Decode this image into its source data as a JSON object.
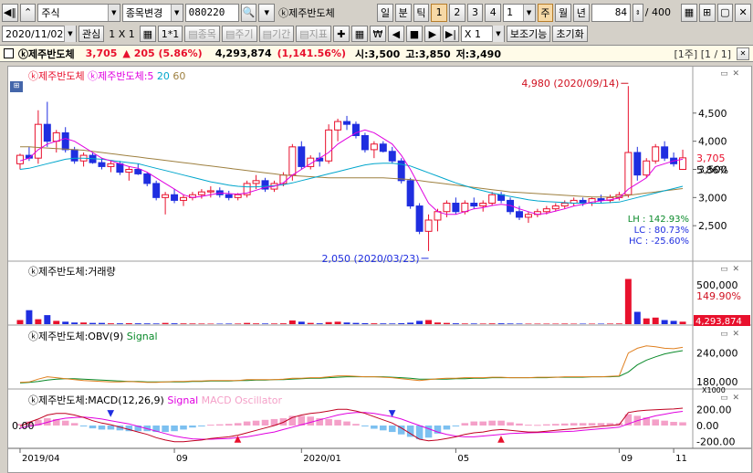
{
  "toolbar": {
    "market": "주식",
    "code_change": "종목변경",
    "code": "080220",
    "stock_name": "ⓚ제주반도체",
    "periods": [
      "일",
      "분",
      "틱"
    ],
    "numbers": [
      "1",
      "2",
      "3",
      "4"
    ],
    "minute_value": "1",
    "periods2": [
      "주",
      "월",
      "년"
    ],
    "count_value": "84",
    "count_total": "/ 400"
  },
  "toolbar2": {
    "date": "2020/11/02",
    "interest": "관심",
    "layout": "1 X 1",
    "grid1": "1*1",
    "item_btn": "종목",
    "period_btn": "주기",
    "range_btn": "기간",
    "indicator_btn": "지표",
    "won": "₩",
    "zoom": "X 1",
    "assist": "보조기능",
    "reset": "초기화"
  },
  "infobar": {
    "name": "ⓚ제주반도체",
    "price": "3,705",
    "change": "▲ 205 (5.86%)",
    "volume": "4,293,874",
    "volume_change": "(1,141.56%)",
    "open": "시:3,500",
    "high": "고:3,850",
    "low": "저:3,490",
    "page": "[1주] [1 / 1]"
  },
  "price_panel": {
    "legend_name": "ⓚ제주반도체",
    "legend_ma": "ⓚ제주반도체:5",
    "legend_ma20": "20",
    "legend_ma60": "60",
    "high_label": "4,980 (2020/09/14)",
    "low_label": "2,050 (2020/03/23)",
    "stats": [
      "LH : 142.93%",
      "LC :  80.73%",
      "HC : -25.60%"
    ],
    "y_ticks": [
      "4,500",
      "4,000",
      "3,500",
      "3,000",
      "2,500"
    ],
    "last_price": "3,705",
    "last_pct": "5.86%"
  },
  "volume_panel": {
    "legend": "ⓚ제주반도체:거래량",
    "y_ticks": [
      "500,000",
      "149.90%"
    ],
    "last_volume": "4,293,874"
  },
  "obv_panel": {
    "legend": "ⓚ제주반도체:OBV(9)",
    "legend_signal": "Signal",
    "y_ticks": [
      "240,000",
      "180,000",
      "X1000"
    ]
  },
  "macd_panel": {
    "legend": "ⓚ제주반도체:MACD(12,26,9)",
    "legend_signal": "Signal",
    "legend_osc": "MACD Oscillator",
    "left_value": "0.00",
    "y_ticks": [
      "200.00",
      "0.00",
      "-200.00"
    ]
  },
  "x_axis": [
    "2019/04",
    "09",
    "2020/01",
    "05",
    "09",
    "11"
  ],
  "colors": {
    "up": "#e8112d",
    "down": "#1f2ee0",
    "ma5": "#e000e0",
    "ma20": "#00a6cc",
    "ma60": "#9e8040"
  },
  "chart_data": [
    {
      "type": "candlestick",
      "title": "ⓚ제주반도체 weekly",
      "x": [
        "2019/04",
        "09",
        "2020/01",
        "05",
        "09",
        "11"
      ],
      "ylim": [
        2000,
        5000
      ],
      "candles": [
        [
          3600,
          3780,
          3500,
          3750
        ],
        [
          3750,
          3900,
          3650,
          3700
        ],
        [
          3700,
          4550,
          3600,
          4300
        ],
        [
          4300,
          4700,
          3900,
          4000
        ],
        [
          4000,
          4200,
          3800,
          4150
        ],
        [
          4150,
          4250,
          3800,
          3850
        ],
        [
          3850,
          3900,
          3600,
          3650
        ],
        [
          3650,
          3800,
          3550,
          3750
        ],
        [
          3750,
          3800,
          3600,
          3620
        ],
        [
          3620,
          3700,
          3500,
          3550
        ],
        [
          3550,
          3650,
          3450,
          3600
        ],
        [
          3600,
          3650,
          3400,
          3450
        ],
        [
          3450,
          3550,
          3300,
          3500
        ],
        [
          3500,
          3600,
          3400,
          3420
        ],
        [
          3420,
          3450,
          3200,
          3250
        ],
        [
          3250,
          3300,
          2950,
          3000
        ],
        [
          3000,
          3100,
          2700,
          3050
        ],
        [
          3050,
          3150,
          2900,
          2950
        ],
        [
          2950,
          3050,
          2850,
          3000
        ],
        [
          3000,
          3100,
          2950,
          3050
        ],
        [
          3050,
          3150,
          2980,
          3100
        ],
        [
          3100,
          3200,
          3000,
          3120
        ],
        [
          3120,
          3180,
          3000,
          3050
        ],
        [
          3050,
          3120,
          2950,
          3000
        ],
        [
          3000,
          3080,
          2950,
          3050
        ],
        [
          3050,
          3300,
          3000,
          3250
        ],
        [
          3250,
          3400,
          3150,
          3300
        ],
        [
          3300,
          3350,
          3100,
          3150
        ],
        [
          3150,
          3300,
          3100,
          3250
        ],
        [
          3250,
          3450,
          3200,
          3400
        ],
        [
          3400,
          3950,
          3300,
          3900
        ],
        [
          3900,
          4000,
          3500,
          3550
        ],
        [
          3550,
          3750,
          3500,
          3700
        ],
        [
          3700,
          3800,
          3550,
          3650
        ],
        [
          3650,
          4300,
          3600,
          4200
        ],
        [
          4200,
          4400,
          4000,
          4350
        ],
        [
          4350,
          4450,
          4200,
          4300
        ],
        [
          4300,
          4350,
          4050,
          4100
        ],
        [
          4100,
          4150,
          3800,
          3850
        ],
        [
          3850,
          4000,
          3700,
          3950
        ],
        [
          3950,
          4000,
          3800,
          3820
        ],
        [
          3820,
          3900,
          3600,
          3650
        ],
        [
          3650,
          3700,
          3250,
          3300
        ],
        [
          3300,
          3350,
          2800,
          2850
        ],
        [
          2850,
          2900,
          2350,
          2400
        ],
        [
          2400,
          2700,
          2050,
          2600
        ],
        [
          2600,
          2800,
          2400,
          2750
        ],
        [
          2750,
          2950,
          2650,
          2900
        ],
        [
          2900,
          3000,
          2700,
          2750
        ],
        [
          2750,
          2950,
          2700,
          2900
        ],
        [
          2900,
          3000,
          2800,
          2850
        ],
        [
          2850,
          2950,
          2750,
          2900
        ],
        [
          2900,
          3100,
          2850,
          3050
        ],
        [
          3050,
          3100,
          2900,
          2950
        ],
        [
          2950,
          3000,
          2700,
          2750
        ],
        [
          2750,
          2850,
          2600,
          2650
        ],
        [
          2650,
          2750,
          2550,
          2700
        ],
        [
          2700,
          2800,
          2650,
          2750
        ],
        [
          2750,
          2850,
          2700,
          2800
        ],
        [
          2800,
          2900,
          2750,
          2850
        ],
        [
          2850,
          2950,
          2800,
          2900
        ],
        [
          2900,
          3000,
          2850,
          2950
        ],
        [
          2950,
          3000,
          2850,
          2900
        ],
        [
          2900,
          3000,
          2850,
          2980
        ],
        [
          2980,
          3050,
          2900,
          2950
        ],
        [
          2950,
          3050,
          2900,
          3000
        ],
        [
          3000,
          3100,
          2950,
          3050
        ],
        [
          3050,
          4980,
          3000,
          3800
        ],
        [
          3800,
          3900,
          3300,
          3400
        ],
        [
          3400,
          3700,
          3350,
          3650
        ],
        [
          3650,
          3950,
          3600,
          3900
        ],
        [
          3900,
          4000,
          3650,
          3700
        ],
        [
          3700,
          3800,
          3550,
          3600
        ],
        [
          3500,
          3850,
          3490,
          3705
        ]
      ],
      "ma5": [
        3650,
        3700,
        3850,
        3950,
        4000,
        4050,
        4000,
        3900,
        3800,
        3700,
        3650,
        3600,
        3550,
        3520,
        3450,
        3350,
        3250,
        3150,
        3050,
        3000,
        3020,
        3050,
        3080,
        3070,
        3060,
        3080,
        3130,
        3180,
        3200,
        3260,
        3400,
        3500,
        3600,
        3700,
        3800,
        3950,
        4050,
        4150,
        4200,
        4150,
        4050,
        3950,
        3750,
        3500,
        3200,
        2900,
        2750,
        2700,
        2700,
        2750,
        2800,
        2820,
        2860,
        2880,
        2860,
        2800,
        2750,
        2700,
        2720,
        2760,
        2800,
        2850,
        2880,
        2920,
        2940,
        2960,
        2990,
        3150,
        3250,
        3350,
        3550,
        3600,
        3650,
        3680
      ],
      "ma20": [
        3500,
        3520,
        3560,
        3600,
        3640,
        3680,
        3700,
        3700,
        3690,
        3680,
        3660,
        3640,
        3620,
        3600,
        3560,
        3520,
        3480,
        3440,
        3400,
        3360,
        3320,
        3280,
        3250,
        3220,
        3200,
        3190,
        3190,
        3200,
        3210,
        3230,
        3260,
        3300,
        3340,
        3380,
        3420,
        3460,
        3500,
        3540,
        3580,
        3600,
        3610,
        3610,
        3590,
        3560,
        3500,
        3440,
        3380,
        3320,
        3260,
        3210,
        3160,
        3120,
        3080,
        3050,
        3020,
        2990,
        2960,
        2940,
        2930,
        2920,
        2910,
        2900,
        2900,
        2900,
        2900,
        2910,
        2920,
        2960,
        3000,
        3040,
        3080,
        3120,
        3160,
        3200
      ],
      "ma60": [
        3900,
        3900,
        3890,
        3880,
        3870,
        3860,
        3850,
        3840,
        3820,
        3800,
        3780,
        3760,
        3740,
        3720,
        3700,
        3680,
        3660,
        3640,
        3620,
        3600,
        3580,
        3560,
        3540,
        3520,
        3500,
        3480,
        3460,
        3440,
        3420,
        3400,
        3390,
        3380,
        3370,
        3360,
        3350,
        3350,
        3350,
        3350,
        3350,
        3350,
        3350,
        3340,
        3330,
        3320,
        3300,
        3280,
        3260,
        3240,
        3220,
        3200,
        3180,
        3160,
        3140,
        3120,
        3100,
        3090,
        3080,
        3070,
        3060,
        3050,
        3040,
        3030,
        3020,
        3010,
        3010,
        3010,
        3020,
        3040,
        3060,
        3080,
        3100,
        3120,
        3140,
        3160
      ]
    },
    {
      "type": "bar",
      "title": "ⓚ제주반도체:거래량",
      "values": [
        500,
        1700,
        600,
        1100,
        400,
        300,
        200,
        200,
        150,
        150,
        100,
        100,
        120,
        100,
        90,
        80,
        150,
        100,
        90,
        80,
        70,
        60,
        60,
        70,
        70,
        150,
        90,
        80,
        80,
        100,
        450,
        300,
        150,
        100,
        250,
        300,
        200,
        150,
        120,
        100,
        90,
        80,
        120,
        180,
        400,
        500,
        200,
        150,
        100,
        80,
        80,
        70,
        90,
        100,
        80,
        70,
        60,
        60,
        60,
        60,
        70,
        60,
        60,
        60,
        60,
        70,
        80,
        5500,
        1500,
        700,
        800,
        500,
        400,
        300
      ],
      "ylim": [
        0,
        6000
      ]
    },
    {
      "type": "line",
      "title": "ⓚ제주반도체:OBV(9)",
      "series": [
        {
          "name": "OBV(9)",
          "values": [
            178,
            179,
            185,
            190,
            188,
            186,
            184,
            182,
            181,
            180,
            179,
            179,
            180,
            179,
            178,
            178,
            179,
            180,
            180,
            181,
            181,
            182,
            182,
            182,
            182,
            184,
            184,
            184,
            184,
            185,
            187,
            187,
            188,
            188,
            190,
            192,
            192,
            191,
            190,
            190,
            189,
            188,
            186,
            184,
            182,
            184,
            186,
            187,
            187,
            188,
            188,
            188,
            189,
            189,
            188,
            188,
            188,
            189,
            189,
            189,
            190,
            190,
            190,
            190,
            190,
            191,
            192,
            240,
            250,
            255,
            253,
            250,
            249,
            252
          ]
        },
        {
          "name": "Signal",
          "values": [
            177,
            178,
            180,
            183,
            185,
            186,
            186,
            185,
            184,
            183,
            182,
            181,
            180,
            180,
            179,
            179,
            179,
            179,
            179,
            180,
            180,
            181,
            181,
            181,
            182,
            182,
            183,
            183,
            184,
            184,
            185,
            186,
            187,
            187,
            188,
            189,
            190,
            190,
            190,
            190,
            190,
            189,
            188,
            187,
            185,
            185,
            185,
            185,
            186,
            186,
            187,
            187,
            188,
            188,
            188,
            188,
            188,
            188,
            188,
            189,
            189,
            189,
            189,
            190,
            190,
            190,
            191,
            200,
            215,
            225,
            232,
            238,
            242,
            245
          ]
        }
      ],
      "ylim": [
        170,
        270
      ]
    },
    {
      "type": "line",
      "title": "ⓚ제주반도체:MACD(12,26,9)",
      "series": [
        {
          "name": "MACD",
          "values": [
            -10,
            40,
            80,
            130,
            150,
            150,
            130,
            100,
            60,
            30,
            10,
            -20,
            -50,
            -80,
            -110,
            -150,
            -180,
            -200,
            -200,
            -190,
            -180,
            -160,
            -150,
            -140,
            -120,
            -90,
            -60,
            -30,
            0,
            40,
            100,
            130,
            150,
            160,
            180,
            200,
            200,
            180,
            150,
            110,
            70,
            30,
            -30,
            -100,
            -170,
            -190,
            -180,
            -160,
            -140,
            -110,
            -90,
            -80,
            -60,
            -50,
            -60,
            -70,
            -80,
            -80,
            -70,
            -60,
            -50,
            -40,
            -30,
            -20,
            -10,
            0,
            10,
            160,
            180,
            190,
            195,
            200,
            205,
            215
          ]
        },
        {
          "name": "Signal",
          "values": [
            -30,
            -10,
            10,
            40,
            70,
            90,
            100,
            105,
            95,
            80,
            60,
            40,
            20,
            -10,
            -40,
            -70,
            -100,
            -130,
            -150,
            -165,
            -170,
            -170,
            -165,
            -160,
            -150,
            -140,
            -120,
            -100,
            -80,
            -50,
            -20,
            10,
            40,
            70,
            100,
            130,
            150,
            160,
            160,
            150,
            130,
            110,
            80,
            40,
            0,
            -40,
            -80,
            -110,
            -130,
            -140,
            -140,
            -130,
            -120,
            -110,
            -100,
            -95,
            -90,
            -88,
            -85,
            -80,
            -75,
            -70,
            -60,
            -50,
            -40,
            -30,
            -20,
            20,
            60,
            90,
            120,
            140,
            160,
            175
          ]
        },
        {
          "name": "MACD Oscillator",
          "values": [
            20,
            50,
            70,
            90,
            80,
            60,
            30,
            -5,
            -35,
            -50,
            -50,
            -60,
            -70,
            -70,
            -70,
            -80,
            -80,
            -70,
            -50,
            -25,
            -10,
            10,
            15,
            20,
            30,
            50,
            60,
            70,
            80,
            90,
            120,
            120,
            110,
            90,
            80,
            70,
            50,
            20,
            -10,
            -40,
            -60,
            -80,
            -110,
            -140,
            -170,
            -150,
            -100,
            -50,
            -10,
            30,
            50,
            50,
            60,
            60,
            40,
            25,
            10,
            8,
            15,
            20,
            25,
            30,
            30,
            30,
            30,
            30,
            30,
            140,
            120,
            100,
            75,
            60,
            45,
            40
          ]
        }
      ],
      "ylim": [
        -260,
        260
      ]
    }
  ]
}
